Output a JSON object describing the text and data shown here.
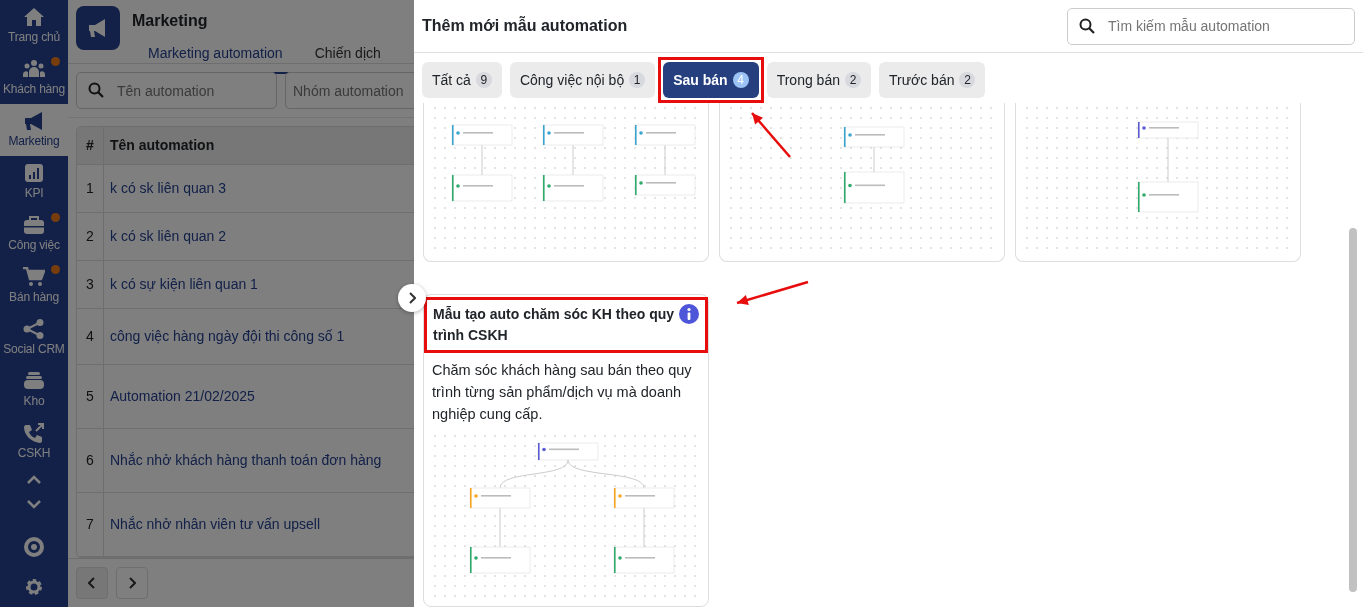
{
  "sidebar": {
    "items": [
      {
        "label": "Trang chủ",
        "selected": false,
        "notification": false
      },
      {
        "label": "Khách hàng",
        "selected": false,
        "notification": true
      },
      {
        "label": "Marketing",
        "selected": true,
        "notification": false
      },
      {
        "label": "KPI",
        "selected": false,
        "notification": false
      },
      {
        "label": "Công việc",
        "selected": false,
        "notification": true
      },
      {
        "label": "Bán hàng",
        "selected": false,
        "notification": true
      },
      {
        "label": "Social CRM",
        "selected": false,
        "notification": false
      },
      {
        "label": "Kho",
        "selected": false,
        "notification": false
      },
      {
        "label": "CSKH",
        "selected": false,
        "notification": false
      }
    ]
  },
  "page": {
    "title": "Marketing",
    "tabs": [
      {
        "label": "Marketing automation",
        "selected": true
      },
      {
        "label": "Chiến dịch",
        "selected": false
      }
    ],
    "search": {
      "placeholder": "Tên automation"
    },
    "group_select": {
      "placeholder": "Nhóm automation"
    },
    "table": {
      "columns": [
        "#",
        "Tên automation"
      ],
      "rows": [
        {
          "index": "1",
          "name": "k có sk liên quan 3"
        },
        {
          "index": "2",
          "name": "k có sk liên quan 2"
        },
        {
          "index": "3",
          "name": "k có sự kiện liên quan 1"
        },
        {
          "index": "4",
          "name": "công việc hàng ngày đội thi công số 1"
        },
        {
          "index": "5",
          "name": "Automation 21/02/2025"
        },
        {
          "index": "6",
          "name": "Nhắc nhở khách hàng thanh toán đơn hàng"
        },
        {
          "index": "7",
          "name": "Nhắc nhở nhân viên tư vấn upsell"
        }
      ]
    }
  },
  "drawer": {
    "title": "Thêm mới mẫu automation",
    "search": {
      "placeholder": "Tìm kiếm mẫu automation"
    },
    "tabs": [
      {
        "label": "Tất cả",
        "count": "9",
        "selected": false,
        "highlighted": false
      },
      {
        "label": "Công việc nội bộ",
        "count": "1",
        "selected": false,
        "highlighted": false
      },
      {
        "label": "Sau bán",
        "count": "4",
        "selected": true,
        "highlighted": true
      },
      {
        "label": "Trong bán",
        "count": "2",
        "selected": false,
        "highlighted": false
      },
      {
        "label": "Trước bán",
        "count": "2",
        "selected": false,
        "highlighted": false
      }
    ],
    "templates": [
      {
        "kind": "picture"
      },
      {
        "kind": "picture"
      },
      {
        "kind": "picture"
      },
      {
        "title": "Mẫu tạo auto chăm sóc KH theo quy trình CSKH",
        "description": "Chăm sóc khách hàng sau bán theo quy trình từng sản phẩm/dịch vụ mà doanh nghiệp cung cấp.",
        "highlighted": true
      }
    ],
    "annotations": [
      {
        "kind": "arrow"
      },
      {
        "kind": "arrow"
      }
    ]
  }
}
